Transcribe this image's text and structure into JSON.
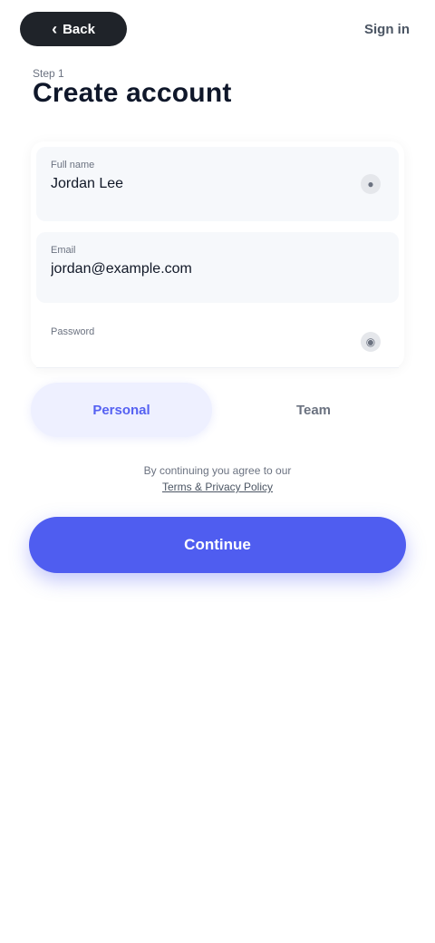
{
  "topbar": {
    "back_label": "Back",
    "back_icon": "chevron-left",
    "action_label": "Sign in"
  },
  "header": {
    "eyebrow": "Step 1",
    "title": "Create account"
  },
  "form": {
    "name": {
      "label": "Full name",
      "value": "Jordan Lee"
    },
    "email": {
      "label": "Email",
      "value": "jordan@example.com"
    },
    "password": {
      "label": "Password",
      "value": "",
      "placeholder": ""
    }
  },
  "plan": {
    "options": [
      "Personal",
      "Team"
    ],
    "selected": "Personal"
  },
  "terms": {
    "text": "By continuing you agree to our",
    "link": "Terms & Privacy Policy"
  },
  "primary_button": {
    "label": "Continue"
  },
  "colors": {
    "accent": "#4f5df0",
    "accent_soft": "#eef0ff",
    "field_bg": "#f6f8fb",
    "pill_dark": "#1f2329"
  }
}
